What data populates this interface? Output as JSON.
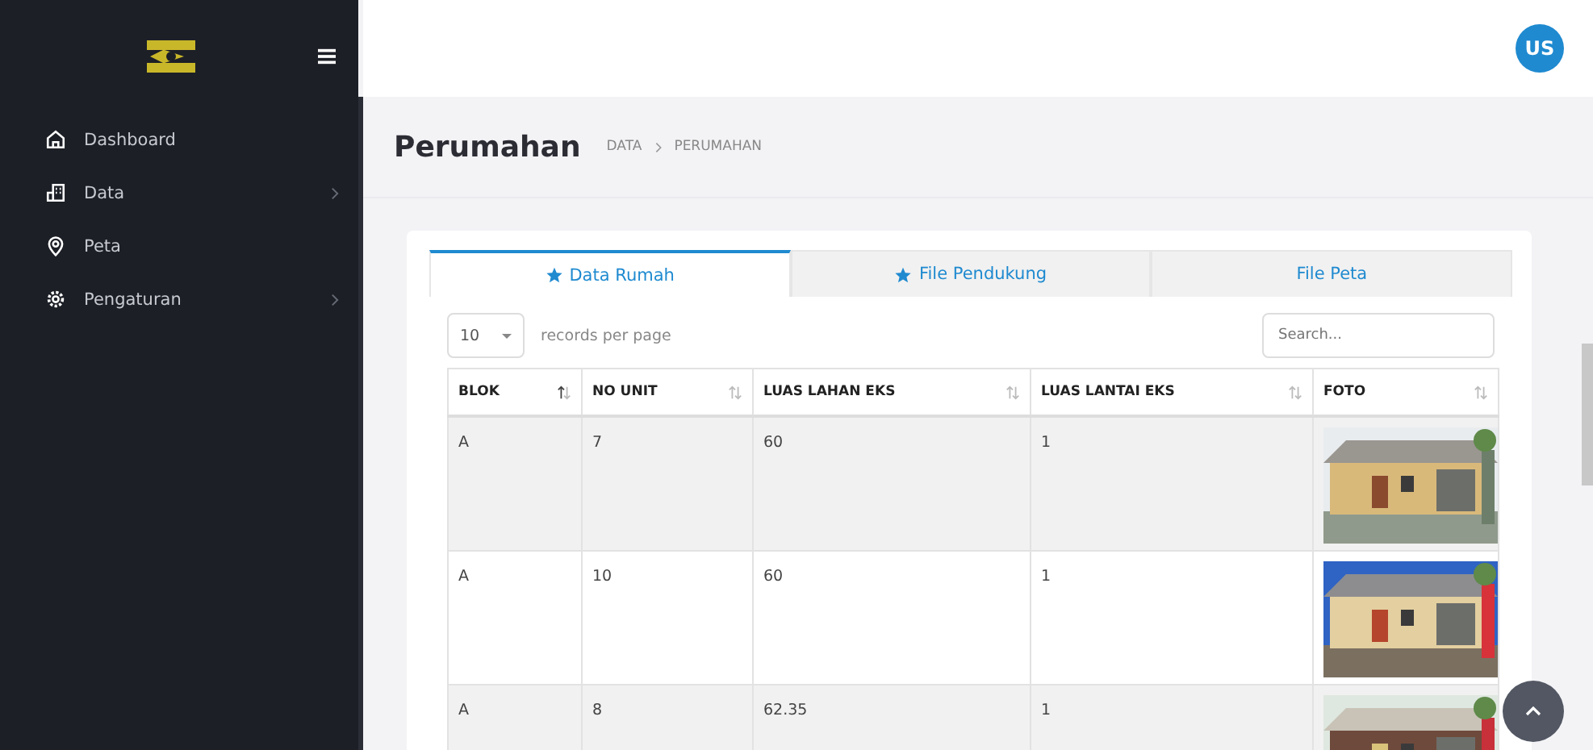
{
  "sidebar": {
    "items": [
      {
        "label": "Dashboard",
        "has_submenu": false
      },
      {
        "label": "Data",
        "has_submenu": true
      },
      {
        "label": "Peta",
        "has_submenu": false
      },
      {
        "label": "Pengaturan",
        "has_submenu": true
      }
    ]
  },
  "user": {
    "initials": "US"
  },
  "page": {
    "title": "Perumahan",
    "breadcrumb": [
      "DATA",
      "PERUMAHAN"
    ]
  },
  "tabs": [
    {
      "label": "Data Rumah",
      "selected": true,
      "starred": true
    },
    {
      "label": "File Pendukung",
      "selected": false,
      "starred": true
    },
    {
      "label": "File Peta",
      "selected": false,
      "starred": false
    }
  ],
  "length_select": {
    "value": "10",
    "label": "records per page"
  },
  "search": {
    "placeholder": "Search..."
  },
  "table": {
    "columns": [
      {
        "label": "BLOK",
        "sorted": true
      },
      {
        "label": "NO UNIT",
        "sorted": false
      },
      {
        "label": "LUAS LAHAN EKS",
        "sorted": false
      },
      {
        "label": "LUAS LANTAI EKS",
        "sorted": false
      },
      {
        "label": "FOTO",
        "sorted": false
      }
    ],
    "rows": [
      {
        "blok": "A",
        "no_unit": "7",
        "luas_lahan": "60",
        "luas_lantai": "1"
      },
      {
        "blok": "A",
        "no_unit": "10",
        "luas_lahan": "60",
        "luas_lantai": "1"
      },
      {
        "blok": "A",
        "no_unit": "8",
        "luas_lahan": "62.35",
        "luas_lantai": "1"
      }
    ]
  }
}
